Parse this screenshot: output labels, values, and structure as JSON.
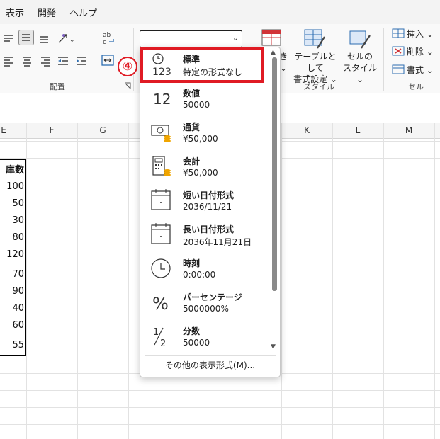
{
  "menu": {
    "items": [
      "表示",
      "開発",
      "ヘルプ"
    ]
  },
  "ribbon": {
    "groups": {
      "alignment": "配置",
      "styles": "スタイル",
      "cells": "セル"
    },
    "number_format_value": "",
    "styles_buttons": {
      "table_format": [
        "テーブルとして",
        "書式設定 ⌄"
      ],
      "cell_styles": [
        "セルの",
        "スタイル ⌄"
      ],
      "conditional_partial": [
        "き",
        "⌄"
      ]
    },
    "cells_buttons": {
      "insert": "挿入 ⌄",
      "delete": "削除 ⌄",
      "format": "書式 ⌄"
    },
    "step_badge": "④"
  },
  "columns": [
    "E",
    "F",
    "G",
    "K",
    "L",
    "M"
  ],
  "cells": {
    "header": "庫数",
    "values": [
      "100",
      "50",
      "30",
      "80",
      "120",
      "70",
      "90",
      "40",
      "60",
      "55"
    ]
  },
  "dropdown": {
    "items": [
      {
        "icon": "clock-123-icon",
        "title": "標準",
        "sub": "特定の形式なし"
      },
      {
        "icon": "number-12-icon",
        "title": "数値",
        "sub": "50000"
      },
      {
        "icon": "currency-icon",
        "title": "通貨",
        "sub": "¥50,000"
      },
      {
        "icon": "accounting-icon",
        "title": "会計",
        "sub": " ¥50,000"
      },
      {
        "icon": "calendar-short-icon",
        "title": "短い日付形式",
        "sub": "2036/11/21"
      },
      {
        "icon": "calendar-long-icon",
        "title": "長い日付形式",
        "sub": "2036年11月21日"
      },
      {
        "icon": "clock-icon",
        "title": "時刻",
        "sub": "0:00:00"
      },
      {
        "icon": "percent-icon",
        "title": "パーセンテージ",
        "sub": "5000000%"
      },
      {
        "icon": "fraction-icon",
        "title": "分数",
        "sub": "50000"
      }
    ],
    "footer": "その他の表示形式(M)..."
  },
  "colors": {
    "highlight": "#e01b24",
    "accent": "#d13438",
    "blue": "#2b6cb0"
  }
}
